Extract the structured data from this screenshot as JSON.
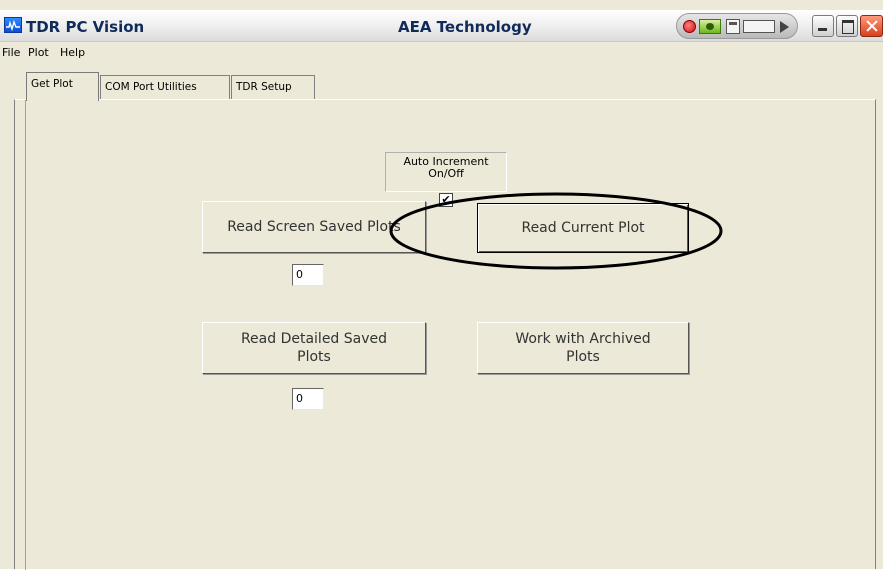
{
  "window": {
    "title": "TDR PC Vision",
    "company": "AEA Technology",
    "controls": [
      "minimize",
      "maximize",
      "close"
    ]
  },
  "menu": [
    "File",
    "Plot",
    "Help"
  ],
  "tabs": [
    {
      "label": "Get Plot",
      "active": true
    },
    {
      "label": "COM Port Utilities",
      "active": false
    },
    {
      "label": "TDR Setup",
      "active": false
    }
  ],
  "get_plot": {
    "auto_increment": {
      "label_line1": "Auto Increment",
      "label_line2": "On/Off",
      "checked": true,
      "check_glyph": "✔"
    },
    "read_screen_saved": {
      "label": "Read Screen Saved Plots",
      "count": "0"
    },
    "read_current": {
      "label": "Read Current Plot"
    },
    "read_detailed_saved": {
      "label_line1": "Read Detailed Saved",
      "label_line2": "Plots",
      "count": "0"
    },
    "work_archived": {
      "label_line1": "Work with Archived",
      "label_line2": "Plots"
    }
  },
  "colors": {
    "window_bg": "#ece9d8",
    "title_text": "#102a5a",
    "annotation": "#000000",
    "close_button": "#d8401c"
  },
  "icons": [
    "app-icon",
    "record-icon",
    "tray-eye-icon",
    "tray-window-icon",
    "minimize-icon",
    "maximize-icon",
    "close-icon"
  ]
}
